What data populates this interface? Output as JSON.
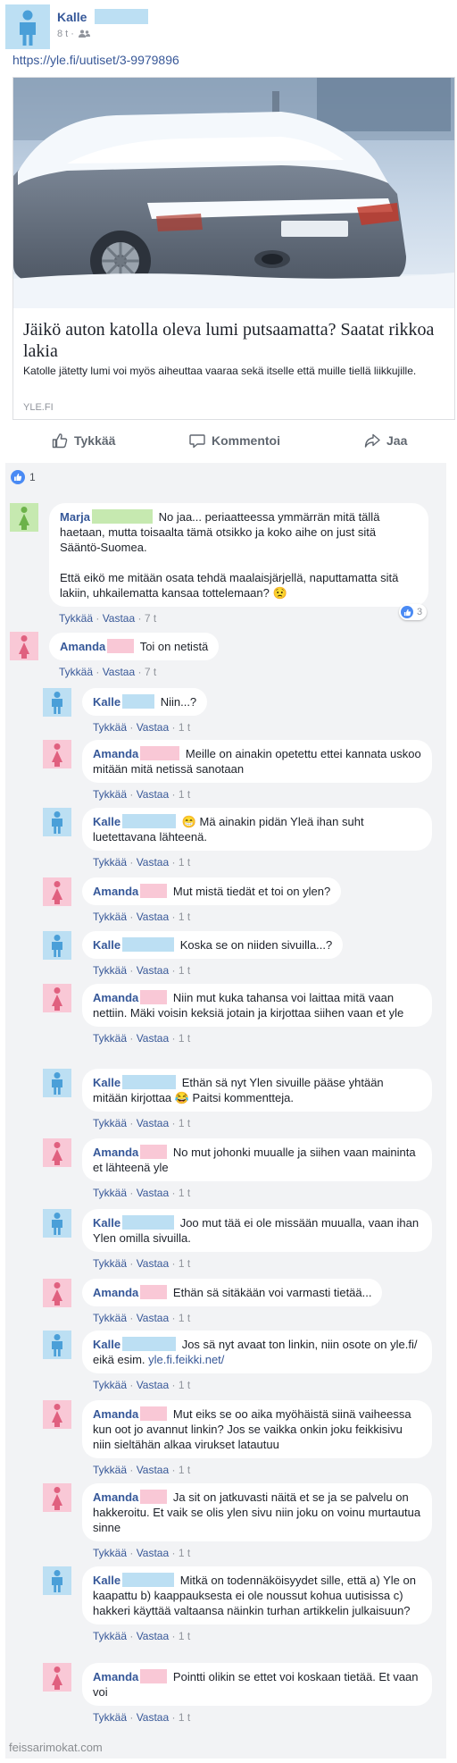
{
  "post": {
    "author": "Kalle",
    "time": "8 t ·",
    "link": "https://yle.fi/uutiset/3-9979896",
    "article": {
      "title": "Jäikö auton katolla oleva lumi putsaamatta? Saatat rikkoa lakia",
      "description": "Katolle jätetty lumi voi myös aiheuttaa vaaraa sekä itselle että muille tiellä liikkujille.",
      "source": "YLE.FI"
    },
    "actions": {
      "like": "Tykkää",
      "comment": "Kommentoi",
      "share": "Jaa"
    },
    "likes_count": "1"
  },
  "comments": [
    {
      "author": "Marja",
      "text": "No jaa... periaatteessa ymmärrän mitä tällä haetaan, mutta toisaalta tämä otsikko ja koko aihe on just sitä Sääntö-Suomea.",
      "text2": "Että eikö me mitään osata tehdä maalaisjärjellä, naputtamatta sitä lakiin, uhkailematta kansaa tottelemaan? 😟",
      "like": "Tykkää",
      "reply": "Vastaa",
      "time": "7 t",
      "reactions": "3"
    },
    {
      "author": "Amanda",
      "text": "Toi on netistä",
      "like": "Tykkää",
      "reply": "Vastaa",
      "time": "7 t"
    },
    {
      "author": "Kalle",
      "text": "Niin...?",
      "like": "Tykkää",
      "reply": "Vastaa",
      "time": "1 t"
    },
    {
      "author": "Amanda",
      "text": "Meille on ainakin opetettu ettei kannata uskoo mitään mitä netissä sanotaan",
      "like": "Tykkää",
      "reply": "Vastaa",
      "time": "1 t"
    },
    {
      "author": "Kalle",
      "text": "😁 Mä ainakin pidän Yleä ihan suht luetettavana lähteenä.",
      "like": "Tykkää",
      "reply": "Vastaa",
      "time": "1 t"
    },
    {
      "author": "Amanda",
      "text": "Mut mistä tiedät et toi on ylen?",
      "like": "Tykkää",
      "reply": "Vastaa",
      "time": "1 t"
    },
    {
      "author": "Kalle",
      "text": "Koska se on niiden sivuilla...?",
      "like": "Tykkää",
      "reply": "Vastaa",
      "time": "1 t"
    },
    {
      "author": "Amanda",
      "text": "Niin mut kuka tahansa voi laittaa mitä vaan nettiin. Mäki voisin keksiä jotain ja kirjottaa siihen vaan et yle",
      "like": "Tykkää",
      "reply": "Vastaa",
      "time": "1 t"
    },
    {
      "author": "Kalle",
      "text": "Ethän sä nyt Ylen sivuille pääse yhtään mitään kirjottaa 😂 Paitsi kommentteja.",
      "like": "Tykkää",
      "reply": "Vastaa",
      "time": "1 t"
    },
    {
      "author": "Amanda",
      "text": "No mut johonki muualle ja siihen vaan maininta et lähteenä yle",
      "like": "Tykkää",
      "reply": "Vastaa",
      "time": "1 t"
    },
    {
      "author": "Kalle",
      "text": "Joo mut tää ei ole missään muualla, vaan ihan Ylen omilla sivuilla.",
      "like": "Tykkää",
      "reply": "Vastaa",
      "time": "1 t"
    },
    {
      "author": "Amanda",
      "text": "Ethän sä sitäkään voi varmasti tietää...",
      "like": "Tykkää",
      "reply": "Vastaa",
      "time": "1 t"
    },
    {
      "author": "Kalle",
      "text": "Jos sä nyt avaat ton linkin, niin osote on yle.fi/ eikä esim.",
      "link": "yle.fi.feikki.net/",
      "like": "Tykkää",
      "reply": "Vastaa",
      "time": "1 t"
    },
    {
      "author": "Amanda",
      "text": "Mut eiks se oo aika myöhäistä siinä vaiheessa kun oot jo avannut linkin? Jos se vaikka onkin joku feikkisivu niin sieltähän alkaa virukset latautuu",
      "like": "Tykkää",
      "reply": "Vastaa",
      "time": "1 t"
    },
    {
      "author": "Amanda",
      "text": "Ja sit on jatkuvasti näitä et se ja se palvelu on hakkeroitu. Et vaik se olis ylen sivu niin joku on voinu murtautua sinne",
      "like": "Tykkää",
      "reply": "Vastaa",
      "time": "1 t"
    },
    {
      "author": "Kalle",
      "text": "Mitkä on todennäköisyydet sille, että a) Yle on kaapattu b) kaappauksesta ei ole noussut kohua uutisissa c) hakkeri käyttää valtaansa näinkin turhan artikkelin julkaisuun?",
      "like": "Tykkää",
      "reply": "Vastaa",
      "time": "1 t"
    },
    {
      "author": "Amanda",
      "text": "Pointti olikin se ettet voi koskaan tietää. Et vaan voi",
      "like": "Tykkää",
      "reply": "Vastaa",
      "time": "1 t"
    }
  ],
  "watermark": "feissarimokat.com",
  "colors": {
    "link_blue": "#365899",
    "bubble_bg": "#ffffff",
    "thread_bg": "#f2f3f5",
    "male_avatar": "#bcdff3",
    "female_avatar": "#f9c8d6",
    "green_avatar": "#c6e9b0"
  }
}
